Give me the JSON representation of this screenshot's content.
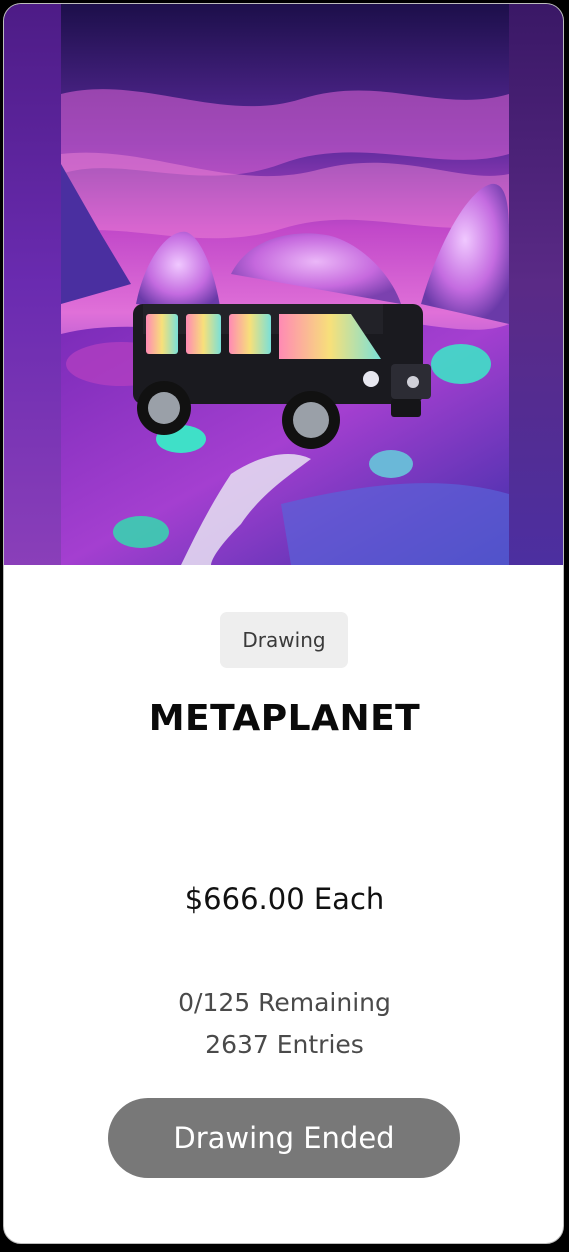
{
  "card": {
    "badge_label": "Drawing",
    "title": "METAPLANET",
    "price": "$666.00 Each",
    "remaining": "0/125 Remaining",
    "entries": "2637 Entries",
    "cta_label": "Drawing Ended"
  },
  "colors": {
    "cta_background": "#787878",
    "badge_background": "#eeeeee",
    "hero_purple": "#6a2aa3",
    "hero_magenta": "#c23bd0",
    "hero_cyan": "#3fe0c8"
  },
  "icons": {
    "hero_image": "suv-in-psychedelic-landscape"
  }
}
